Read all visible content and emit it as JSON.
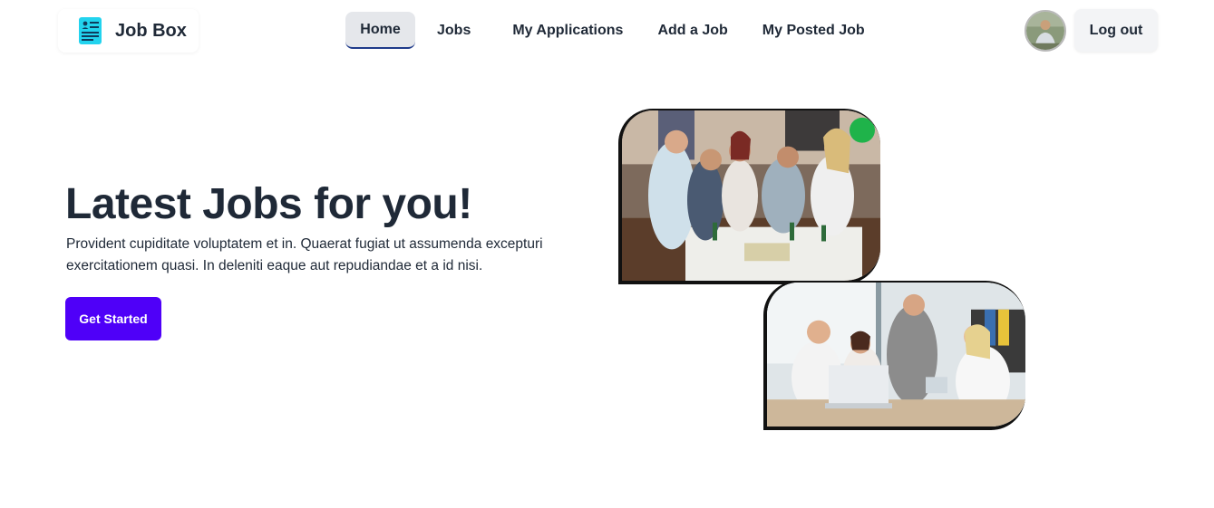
{
  "brand": {
    "name": "Job Box",
    "icon": "document-icon",
    "icon_color": "#22d3ee"
  },
  "nav": {
    "items": [
      {
        "label": "Home",
        "active": true
      },
      {
        "label": "Jobs",
        "active": false
      },
      {
        "label": "My Applications",
        "active": false
      },
      {
        "label": "Add a Job",
        "active": false
      },
      {
        "label": "My Posted Job",
        "active": false
      }
    ]
  },
  "user": {
    "avatar": "user-avatar",
    "logout_label": "Log out"
  },
  "hero": {
    "title": "Latest Jobs for you!",
    "text": "Provident cupiditate voluptatem et in. Quaerat fugiat ut assumenda excepturi exercitationem quasi. In deleniti eaque aut repudiandae et a id nisi.",
    "cta_label": "Get Started",
    "cta_color": "#4f00f8"
  },
  "images": [
    {
      "subject": "group-of-friends-playing-game-photo"
    },
    {
      "subject": "office-team-meeting-photo"
    }
  ]
}
